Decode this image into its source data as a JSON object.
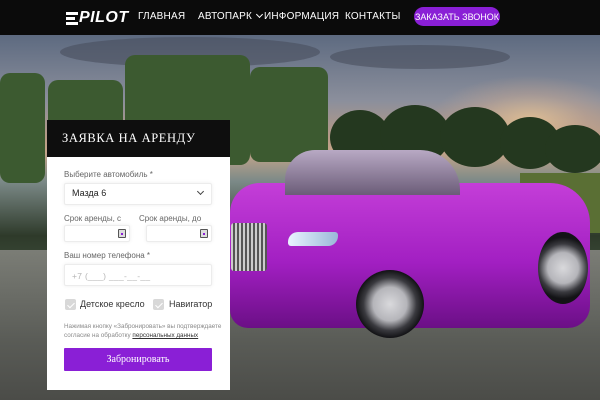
{
  "header": {
    "logo_text": "PILOT",
    "nav": [
      {
        "label": "ГЛАВНАЯ"
      },
      {
        "label": "АВТОПАРК"
      },
      {
        "label": "ИНФОРМАЦИЯ"
      },
      {
        "label": "КОНТАКТЫ"
      }
    ],
    "cta_label": "ЗАКАЗАТЬ ЗВОНОК"
  },
  "form": {
    "title": "ЗАЯВКА НА АРЕНДУ",
    "car_label": "Выберите автомобиль *",
    "car_value": "Мазда 6",
    "date_from_label": "Срок аренды, с",
    "date_to_label": "Срок аренды, до",
    "phone_label": "Ваш номер телефона *",
    "phone_placeholder": "+7 (___) ___-__-__",
    "options": [
      {
        "label": "Детское кресло",
        "checked": true
      },
      {
        "label": "Навигатор",
        "checked": true
      }
    ],
    "disclaimer_text": "Нажимая кнопку «Забронировать» вы подтверждаете согласие на обработку ",
    "disclaimer_link": "персональных данных",
    "submit_label": "Забронировать"
  },
  "colors": {
    "accent": "#8a1fd6",
    "header_bg": "#0b0b0b",
    "car_color": "#b62ccf"
  },
  "icons": {
    "calendar": "calendar-icon",
    "checkbox": "check-icon",
    "dropdown": "chevron-down-icon"
  }
}
